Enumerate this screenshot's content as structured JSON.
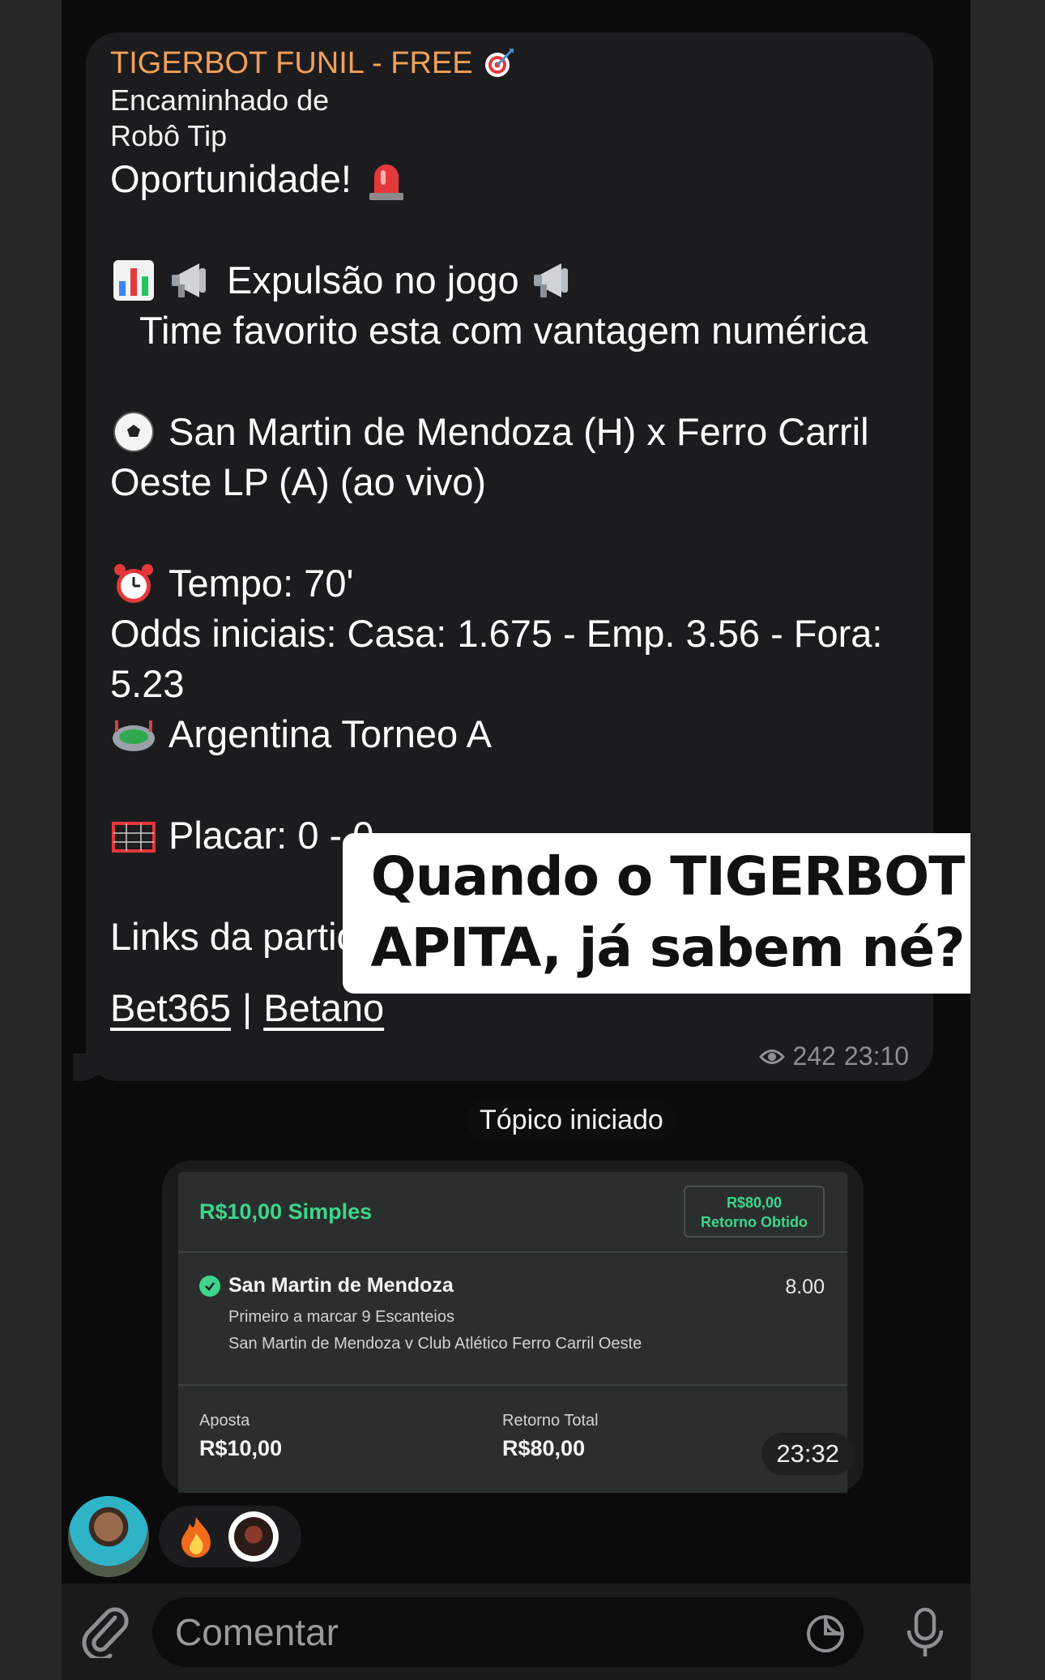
{
  "message": {
    "channel_name": "TIGERBOT FUNIL - FREE",
    "forwarded_label": "Encaminhado de",
    "forwarded_from": "Robô Tip",
    "lines": {
      "opportunity": "Oportunidade!",
      "expulsion": "Expulsão no jogo",
      "advantage": "Time favorito esta com vantagem numérica",
      "match_1": "San Martin de Mendoza (H) x Ferro Carril",
      "match_2": "Oeste LP (A) (ao vivo)",
      "time": "Tempo: 70'",
      "odds_1": "Odds iniciais: Casa: 1.675 - Emp. 3.56 - Fora:",
      "odds_2": "5.23",
      "league": "Argentina Torneo A",
      "score": "Placar: 0 - 0",
      "links_intro": "Links da partida:"
    },
    "links": {
      "bet365": "Bet365",
      "separator": "|",
      "betano": "Betano"
    },
    "views": "242",
    "time": "23:10"
  },
  "overlay": {
    "line1": "Quando o TIGERBOT",
    "line2": "APITA, já sabem né?"
  },
  "topic_label": "Tópico iniciado",
  "bet_slip": {
    "title": "R$10,00 Simples",
    "return_amount": "R$80,00",
    "return_label": "Retorno Obtido",
    "selection": "San Martin de Mendoza",
    "odd": "8.00",
    "market": "Primeiro a marcar 9 Escanteios",
    "event": "San Martin de Mendoza v Club Atlético Ferro Carril Oeste",
    "stake_label": "Aposta",
    "stake_value": "R$10,00",
    "total_label": "Retorno Total",
    "total_value": "R$80,00",
    "time": "23:32"
  },
  "comment": {
    "placeholder": "Comentar"
  },
  "colors": {
    "channel": "#f0a05a",
    "bet_green": "#3dd68c",
    "bubble": "#1c1c1e"
  },
  "icons": [
    "dart-icon",
    "siren-icon",
    "bar-chart-icon",
    "megaphone-icon",
    "soccer-ball-icon",
    "alarm-clock-icon",
    "stadium-icon",
    "goal-icon",
    "eye-icon",
    "check-icon",
    "fire-icon",
    "paperclip-icon",
    "sticker-icon",
    "mic-icon"
  ]
}
